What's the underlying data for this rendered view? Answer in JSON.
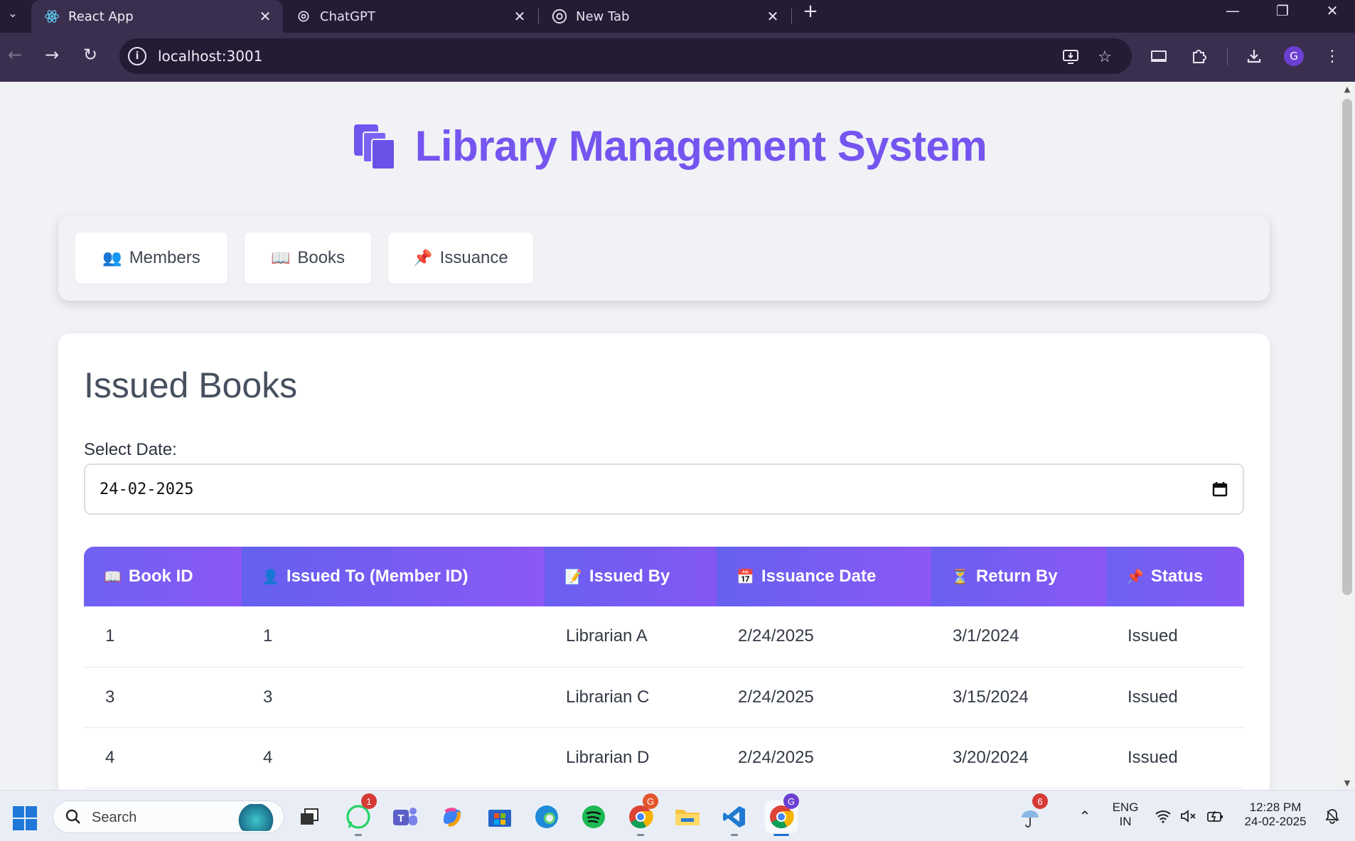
{
  "browser": {
    "tabs": [
      {
        "title": "React App",
        "favicon": "react-icon",
        "active": true
      },
      {
        "title": "ChatGPT",
        "favicon": "chatgpt-icon",
        "active": false
      },
      {
        "title": "New Tab",
        "favicon": "chrome-icon",
        "active": false
      }
    ],
    "url": "localhost:3001",
    "profile_initial": "G"
  },
  "page": {
    "title": "Library Management System",
    "nav": [
      {
        "icon": "👥",
        "label": "Members"
      },
      {
        "icon": "📖",
        "label": "Books"
      },
      {
        "icon": "📌",
        "label": "Issuance"
      }
    ],
    "section_title": "Issued Books",
    "date_label": "Select Date:",
    "date_value": "24-02-2025",
    "table": {
      "columns": [
        {
          "icon": "📖",
          "label": "Book ID"
        },
        {
          "icon": "👤",
          "label": "Issued To (Member ID)"
        },
        {
          "icon": "📝",
          "label": "Issued By"
        },
        {
          "icon": "📅",
          "label": "Issuance Date"
        },
        {
          "icon": "⏳",
          "label": "Return By"
        },
        {
          "icon": "📌",
          "label": "Status"
        }
      ],
      "rows": [
        [
          "1",
          "1",
          "Librarian A",
          "2/24/2025",
          "3/1/2024",
          "Issued"
        ],
        [
          "3",
          "3",
          "Librarian C",
          "2/24/2025",
          "3/15/2024",
          "Issued"
        ],
        [
          "4",
          "4",
          "Librarian D",
          "2/24/2025",
          "3/20/2024",
          "Issued"
        ]
      ]
    }
  },
  "taskbar": {
    "search_placeholder": "Search",
    "whatsapp_badge": "1",
    "chrome_badge": "G",
    "weather_badge": "6",
    "lang_line1": "ENG",
    "lang_line2": "IN",
    "time": "12:28 PM",
    "date": "24-02-2025"
  },
  "colors": {
    "accent": "#7555f0",
    "header_gradient_start": "#6561f0",
    "header_gradient_end": "#8b58f6"
  }
}
